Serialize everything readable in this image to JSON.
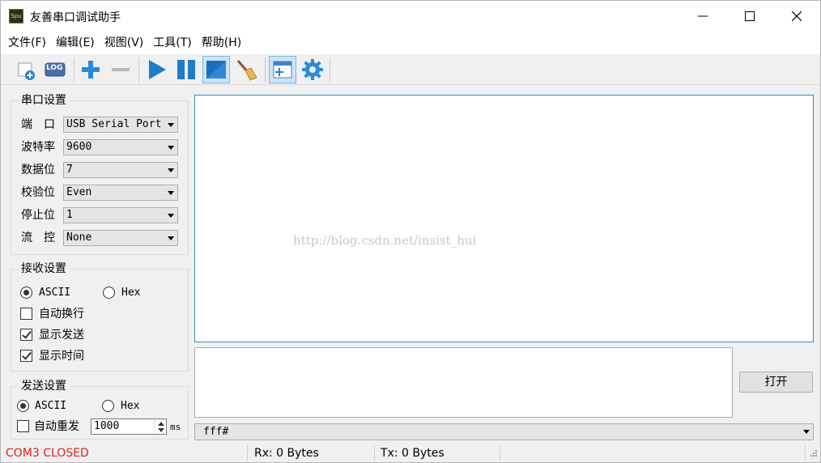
{
  "window": {
    "title": "友善串口调试助手",
    "icon_text": "Spu"
  },
  "menu": [
    {
      "label": "文件(F)"
    },
    {
      "label": "编辑(E)"
    },
    {
      "label": "视图(V)"
    },
    {
      "label": "工具(T)"
    },
    {
      "label": "帮助(H)"
    }
  ],
  "toolbar": {
    "icons": [
      "new-file-icon",
      "log-icon",
      "plus-icon",
      "minus-icon",
      "play-icon",
      "pause-icon",
      "monitor-icon",
      "broom-icon",
      "window-add-icon",
      "gear-icon"
    ],
    "log_text": "LOG",
    "accent": "#1e7cc8"
  },
  "serial": {
    "title": "串口设置",
    "rows": [
      {
        "label": "端　口",
        "value": "USB Serial Port"
      },
      {
        "label": "波特率",
        "value": "9600"
      },
      {
        "label": "数据位",
        "value": "7"
      },
      {
        "label": "校验位",
        "value": "Even"
      },
      {
        "label": "停止位",
        "value": "1"
      },
      {
        "label": "流　控",
        "value": "None"
      }
    ]
  },
  "receive": {
    "title": "接收设置",
    "ascii": "ASCII",
    "hex": "Hex",
    "auto_wrap": "自动换行",
    "show_send": "显示发送",
    "show_time": "显示时间"
  },
  "send": {
    "title": "发送设置",
    "ascii": "ASCII",
    "hex": "Hex",
    "auto_repeat": "自动重发",
    "interval": "1000",
    "unit": "ms"
  },
  "receive_area": {
    "watermark": "http://blog.csdn.net/insist_hui"
  },
  "open_button": "打开",
  "send_history": "fff#",
  "status": {
    "port": "COM3 CLOSED",
    "rx": "Rx: 0 Bytes",
    "tx": "Tx: 0 Bytes",
    "port_color": "#e02020"
  }
}
